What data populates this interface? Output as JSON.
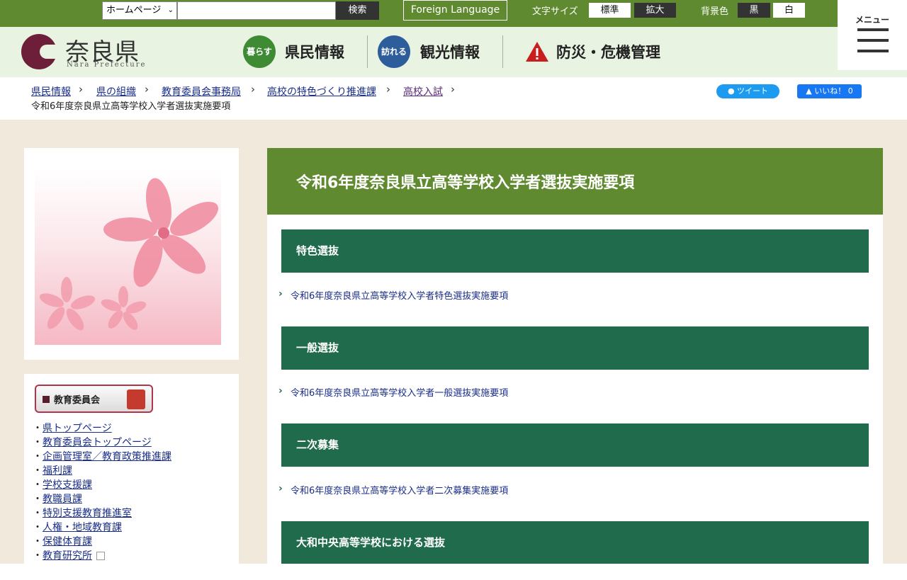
{
  "topbar": {
    "site_select": "ホームページ",
    "search_placeholder": "",
    "search_label": "検索",
    "foreign_label": "Foreign Language",
    "fontsize_label": "文字サイズ",
    "font_standard": "標準",
    "font_large": "拡大",
    "bg_label": "背景色",
    "bg_black": "黒",
    "bg_white": "白",
    "menu_label": "メニュー"
  },
  "header": {
    "logo_text": "奈良県",
    "logo_sub": "Nara Prefecture",
    "nav": [
      {
        "icon_text": "暮らす",
        "label": "県民情報"
      },
      {
        "icon_text": "訪れる",
        "label": "観光情報"
      },
      {
        "label": "防災・危機管理"
      }
    ]
  },
  "breadcrumb": {
    "items": [
      "県民情報",
      "県の組織",
      "教育委員会事務局",
      "高校の特色づくり推進課",
      "高校入試"
    ],
    "current": "令和6年度奈良県立高等学校入学者選抜実施要項",
    "tweet": "ツイート",
    "like": "いいね！ 0"
  },
  "sidebar": {
    "badge_label": "教育委員会",
    "links": [
      "県トップページ",
      "教育委員会トップページ",
      "企画管理室／教育政策推進課",
      "福利課",
      "学校支援課",
      "教職員課",
      "特別支援教育推進室",
      "人権・地域教育課",
      "保健体育課",
      "教育研究所"
    ]
  },
  "main": {
    "title": "令和6年度奈良県立高等学校入学者選抜実施要項",
    "sections": [
      {
        "heading": "特色選抜",
        "link": "令和6年度奈良県立高等学校入学者特色選抜実施要項"
      },
      {
        "heading": "一般選抜",
        "link": "令和6年度奈良県立高等学校入学者一般選抜実施要項"
      },
      {
        "heading": "二次募集",
        "link": "令和6年度奈良県立高等学校入学者二次募集実施要項"
      },
      {
        "heading": "大和中央高等学校における選抜",
        "link": ""
      }
    ]
  },
  "colors": {
    "topbar_green": "#5f8a2f",
    "section_green": "#1f6b4c",
    "link_blue": "#1a2e8a"
  }
}
